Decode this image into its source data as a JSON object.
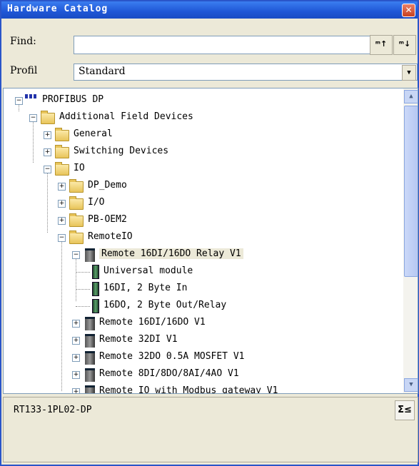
{
  "window": {
    "title": "Hardware Catalog",
    "close_glyph": "✕"
  },
  "find": {
    "label": "Find:",
    "value": "",
    "search_up_label": "ᵐ↑",
    "search_down_label": "ᵐ↓"
  },
  "profile": {
    "label": "Profil",
    "selected": "Standard"
  },
  "tree": {
    "items": [
      {
        "label": "PROFIBUS DP",
        "expander": "−",
        "icon": "profibus-network-icon"
      },
      {
        "label": "Additional Field Devices",
        "expander": "−",
        "icon": "folder-icon"
      },
      {
        "label": "General",
        "expander": "+",
        "icon": "folder-icon"
      },
      {
        "label": "Switching Devices",
        "expander": "+",
        "icon": "folder-icon"
      },
      {
        "label": "IO",
        "expander": "−",
        "icon": "folder-icon"
      },
      {
        "label": "DP_Demo",
        "expander": "+",
        "icon": "folder-icon"
      },
      {
        "label": "I/O",
        "expander": "+",
        "icon": "folder-icon"
      },
      {
        "label": "PB-OEM2",
        "expander": "+",
        "icon": "folder-icon"
      },
      {
        "label": "RemoteIO",
        "expander": "−",
        "icon": "folder-icon"
      },
      {
        "label": "Remote 16DI/16DO Relay V1",
        "expander": "−",
        "icon": "station-icon"
      },
      {
        "label": "Universal module",
        "icon": "module-icon"
      },
      {
        "label": "16DI, 2 Byte In",
        "icon": "module-icon"
      },
      {
        "label": "16DO, 2 Byte Out/Relay",
        "icon": "module-icon"
      },
      {
        "label": "Remote 16DI/16DO V1",
        "expander": "+",
        "icon": "station-icon"
      },
      {
        "label": "Remote 32DI V1",
        "expander": "+",
        "icon": "station-icon"
      },
      {
        "label": "Remote 32DO 0.5A MOSFET V1",
        "expander": "+",
        "icon": "station-icon"
      },
      {
        "label": "Remote 8DI/8DO/8AI/4AO V1",
        "expander": "+",
        "icon": "station-icon"
      },
      {
        "label": "Remote IO with Modbus gateway V1",
        "expander": "+",
        "icon": "station-icon"
      }
    ]
  },
  "scrollbar": {
    "up_glyph": "▲",
    "down_glyph": "▼"
  },
  "info": {
    "text": "RT133-1PL02-DP",
    "sort_label": "Σ≤"
  }
}
